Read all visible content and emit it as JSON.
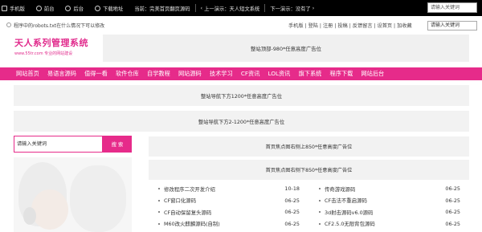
{
  "topbar": {
    "items": [
      {
        "icon": "mobile-icon",
        "label": "手机版"
      },
      {
        "icon": "home-icon",
        "label": "前台"
      },
      {
        "icon": "admin-icon",
        "label": "后台"
      },
      {
        "icon": "download-icon",
        "label": "下载地址"
      }
    ],
    "current_prefix": "当前：",
    "current_page": "完美首页翻页源码",
    "prev_label": "上一演示：",
    "prev_value": "天人短文系统",
    "next_label": "下一演示：",
    "next_value": "没有了",
    "search_placeholder": "请输入关键词"
  },
  "notice": {
    "text": "程序中的robots.txt在什么情况下可以修改"
  },
  "user_links": "手机版 | 登陆 | 注册 | 投稿 | 反馈留言 | 设首页 | 加收藏",
  "search2_placeholder": "请输入关键词",
  "logo": {
    "title": "天人系列管理系统",
    "subtitle": "www.55tr.com 专业的网站建设",
    "color": "#e12c8d"
  },
  "top_ad": "整站顶部-980*任意高度广告位",
  "nav": {
    "color": "#e62b8a",
    "items": [
      "网站首页",
      "易语言源码",
      "值得一看",
      "软件仓库",
      "自学教程",
      "网站源码",
      "技术学习",
      "CF资讯",
      "LOL资讯",
      "旗下系统",
      "程序下载",
      "网站后台"
    ]
  },
  "ads": {
    "nav_below_1": "整站导航下方1200*任意高度广告位",
    "nav_below_2": "整站导航下方2-1200*任意高度广告位",
    "focus_right_top": "首页焦点图右侧上850*任意高度广告位",
    "focus_right_bottom": "首页焦点图右侧下850*任意高度广告位"
  },
  "side_search": {
    "placeholder": "请输入关键词",
    "button": "搜 索"
  },
  "list_left": [
    {
      "title": "修改程序二次开发介绍",
      "date": "10-18"
    },
    {
      "title": "CF窗口化源码",
      "date": "06-25"
    },
    {
      "title": "CF自动保留复头源码",
      "date": "06-25"
    },
    {
      "title": "M60改火麒麟源码(自制)",
      "date": "06-25"
    }
  ],
  "list_right": [
    {
      "title": "传奇游戏源码",
      "date": "06-25"
    },
    {
      "title": "CF击法不重启源码",
      "date": "06-25"
    },
    {
      "title": "3d射击源码v6.0源码",
      "date": "06-25"
    },
    {
      "title": "CF2.5.0无限背包源码",
      "date": "06-25"
    }
  ]
}
